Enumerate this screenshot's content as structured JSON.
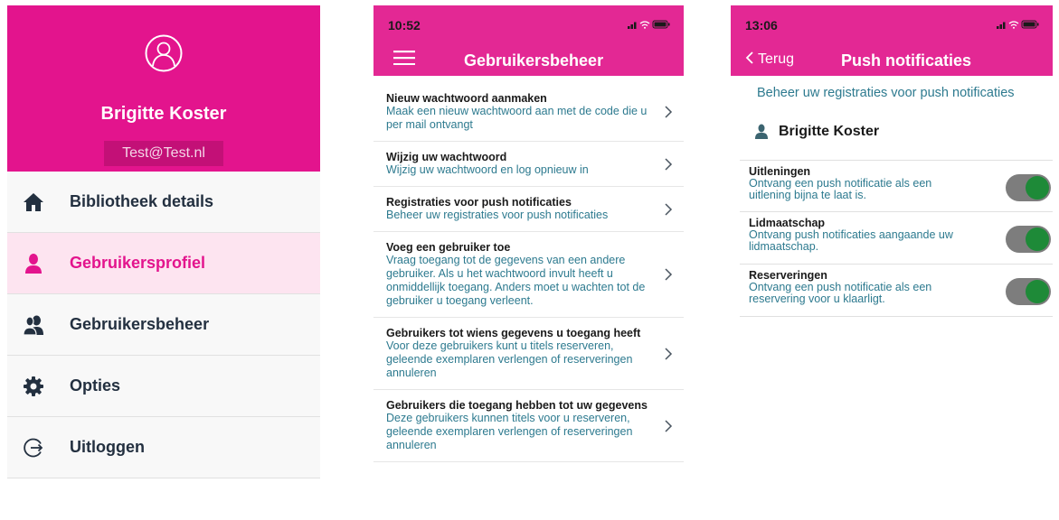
{
  "panel_menu": {
    "user_name": "Brigitte Koster",
    "email": "Test@Test.nl",
    "items": [
      {
        "label": "Bibliotheek details",
        "icon": "home-icon",
        "active": false
      },
      {
        "label": "Gebruikersprofiel",
        "icon": "user-icon",
        "active": true
      },
      {
        "label": "Gebruikersbeheer",
        "icon": "users-icon",
        "active": false
      },
      {
        "label": "Opties",
        "icon": "gear-icon",
        "active": false
      },
      {
        "label": "Uitloggen",
        "icon": "logout-icon",
        "active": false
      }
    ]
  },
  "panel_beheer": {
    "time": "10:52",
    "title": "Gebruikersbeheer",
    "rows": [
      {
        "title": "Nieuw wachtwoord aanmaken",
        "desc": "Maak een nieuw wachtwoord aan met de code die u per mail ontvangt"
      },
      {
        "title": "Wijzig uw wachtwoord",
        "desc": "Wijzig uw wachtwoord en log opnieuw in"
      },
      {
        "title": "Registraties voor push notificaties",
        "desc": "Beheer uw registraties voor push notificaties"
      },
      {
        "title": "Voeg een gebruiker toe",
        "desc": "Vraag toegang tot de gegevens van een andere gebruiker. Als u het wachtwoord invult heeft u onmiddellijk toegang. Anders moet u wachten tot de gebruiker u toegang verleent."
      },
      {
        "title": "Gebruikers tot wiens gegevens u toegang heeft",
        "desc": "Voor deze gebruikers kunt u titels reserveren, geleende exemplaren verlengen of reserveringen annuleren"
      },
      {
        "title": "Gebruikers die toegang hebben tot uw gegevens",
        "desc": "Deze gebruikers kunnen titels voor u reserveren, geleende exemplaren verlengen of reserveringen annuleren"
      }
    ]
  },
  "panel_push": {
    "time": "13:06",
    "back_label": "Terug",
    "title": "Push notificaties",
    "subtitle": "Beheer uw registraties voor push notificaties",
    "user_name": "Brigitte Koster",
    "items": [
      {
        "title": "Uitleningen",
        "desc": "Ontvang een push notificatie als een uitlening bijna te laat is.",
        "enabled": true
      },
      {
        "title": "Lidmaatschap",
        "desc": "Ontvang push notificaties aangaande uw lidmaatschap.",
        "enabled": true
      },
      {
        "title": "Reserveringen",
        "desc": "Ontvang een push notificatie als een reservering voor u klaarligt.",
        "enabled": true
      }
    ]
  },
  "colors": {
    "brand_pink": "#e3148d",
    "active_bg": "#fde4f0",
    "teal_text": "#2d7a8f",
    "toggle_on": "#1e8a38"
  }
}
